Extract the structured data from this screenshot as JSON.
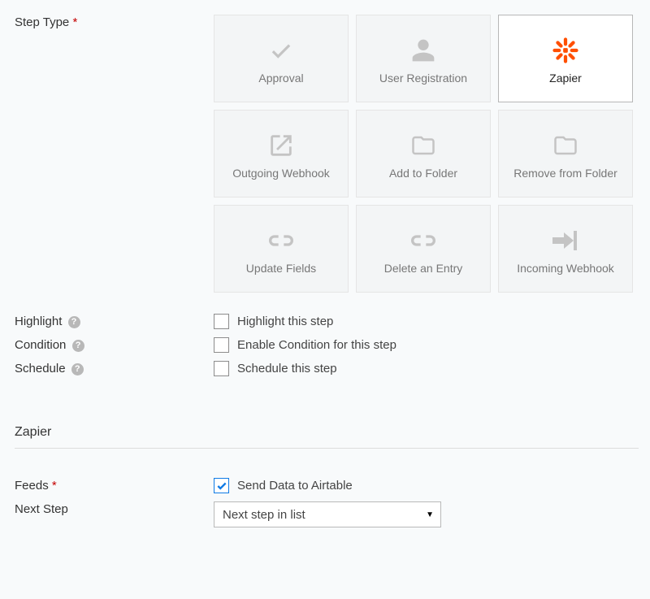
{
  "step_type": {
    "label": "Step Type",
    "required": "*",
    "options": [
      {
        "id": "approval",
        "label": "Approval",
        "icon": "check",
        "selected": false
      },
      {
        "id": "user-registration",
        "label": "User Registration",
        "icon": "user",
        "selected": false
      },
      {
        "id": "zapier",
        "label": "Zapier",
        "icon": "zapier",
        "selected": true
      },
      {
        "id": "outgoing-webhook",
        "label": "Outgoing Webhook",
        "icon": "external",
        "selected": false
      },
      {
        "id": "add-to-folder",
        "label": "Add to Folder",
        "icon": "folder",
        "selected": false
      },
      {
        "id": "remove-from-folder",
        "label": "Remove from Folder",
        "icon": "folder",
        "selected": false
      },
      {
        "id": "update-fields",
        "label": "Update Fields",
        "icon": "link",
        "selected": false
      },
      {
        "id": "delete-entry",
        "label": "Delete an Entry",
        "icon": "link",
        "selected": false
      },
      {
        "id": "incoming-webhook",
        "label": "Incoming Webhook",
        "icon": "arrow-in",
        "selected": false
      }
    ]
  },
  "highlight": {
    "label": "Highlight",
    "checkbox_label": "Highlight this step",
    "checked": false
  },
  "condition": {
    "label": "Condition",
    "checkbox_label": "Enable Condition for this step",
    "checked": false
  },
  "schedule": {
    "label": "Schedule",
    "checkbox_label": "Schedule this step",
    "checked": false
  },
  "section_zapier": {
    "title": "Zapier"
  },
  "feeds": {
    "label": "Feeds",
    "required": "*",
    "checkbox_label": "Send Data to Airtable",
    "checked": true
  },
  "next_step": {
    "label": "Next Step",
    "selected": "Next step in list"
  },
  "help_glyph": "?"
}
